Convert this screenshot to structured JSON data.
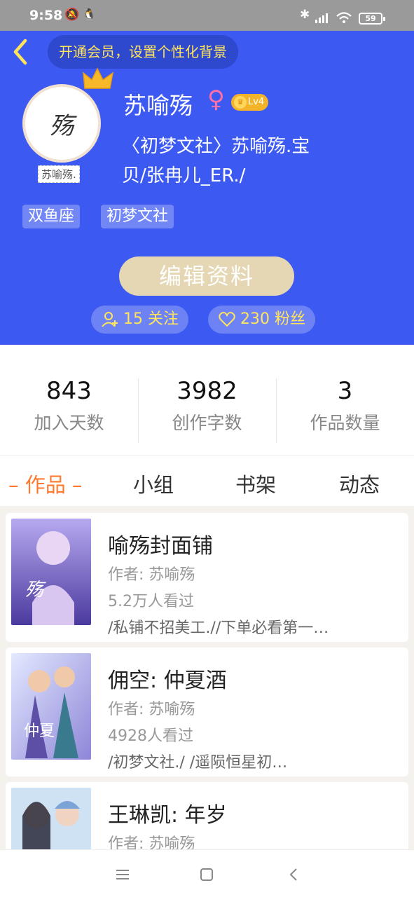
{
  "status_bar": {
    "time": "9:58",
    "battery": "59"
  },
  "header": {
    "promo": "开通会员，设置个性化背景",
    "avatar_caption": "苏喻殇.",
    "avatar_text": "殇",
    "username": "苏喻殇",
    "gender_symbol": "♀",
    "level": "Lv4",
    "bio": "〈初梦文社〉苏喻殇.宝贝/张冉儿_ER./",
    "tags": [
      "双鱼座",
      "初梦文社"
    ],
    "edit_button": "编辑资料",
    "following": "15 关注",
    "followers": "230 粉丝"
  },
  "stats": [
    {
      "value": "843",
      "label": "加入天数"
    },
    {
      "value": "3982",
      "label": "创作字数"
    },
    {
      "value": "3",
      "label": "作品数量"
    }
  ],
  "tabs": [
    "– 作品 –",
    "小组",
    "书架",
    "动态"
  ],
  "works": [
    {
      "title": "喻殇封面铺",
      "author": "作者: 苏喻殇",
      "views": "5.2万人看过",
      "desc": "/私铺不招美工.//下单必看第一…",
      "cover_color": "#7a6fc9"
    },
    {
      "title": "佣空: 仲夏酒",
      "author": "作者: 苏喻殇",
      "views": "4928人看过",
      "desc": "/初梦文社./ /遥陨恒星初…",
      "cover_color": "#9aa7e6"
    },
    {
      "title": "王琳凯: 年岁",
      "author": "作者: 苏喻殇",
      "views": "",
      "desc": "",
      "cover_color": "#cfe2f3"
    }
  ],
  "colors": {
    "header_bg": "#3c59f2",
    "accent": "#ff7a2f",
    "promo_text": "#ffe45c"
  },
  "icons": [
    "back-arrow-icon",
    "crown-icon",
    "gender-female-icon",
    "level-badge-icon",
    "follow-icon",
    "heart-icon",
    "menu-icon",
    "home-icon",
    "back-icon"
  ]
}
